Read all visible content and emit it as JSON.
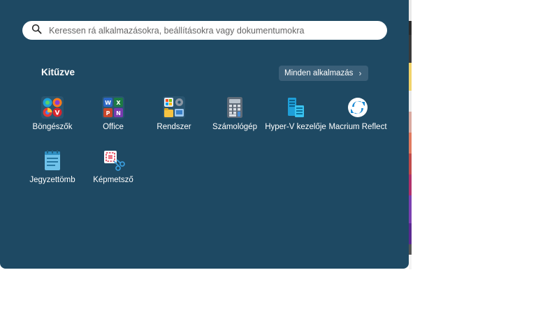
{
  "search": {
    "placeholder": "Keressen rá alkalmazásokra, beállításokra vagy dokumentumokra"
  },
  "pinned": {
    "title": "Kitűzve",
    "all_apps_label": "Minden alkalmazás",
    "apps": [
      {
        "label": "Böngészők",
        "icon": "browsers-folder-icon"
      },
      {
        "label": "Office",
        "icon": "office-folder-icon"
      },
      {
        "label": "Rendszer",
        "icon": "system-folder-icon"
      },
      {
        "label": "Számológép",
        "icon": "calculator-icon"
      },
      {
        "label": "Hyper-V kezelője",
        "icon": "hyper-v-icon"
      },
      {
        "label": "Macrium Reflect",
        "icon": "macrium-reflect-icon"
      },
      {
        "label": "Jegyzettömb",
        "icon": "notepad-icon"
      },
      {
        "label": "Képmetsző",
        "icon": "snipping-tool-icon"
      }
    ]
  },
  "colors": {
    "menu_bg": "#1e4963",
    "button_bg": "#3a5f78",
    "text": "#ffffff"
  }
}
